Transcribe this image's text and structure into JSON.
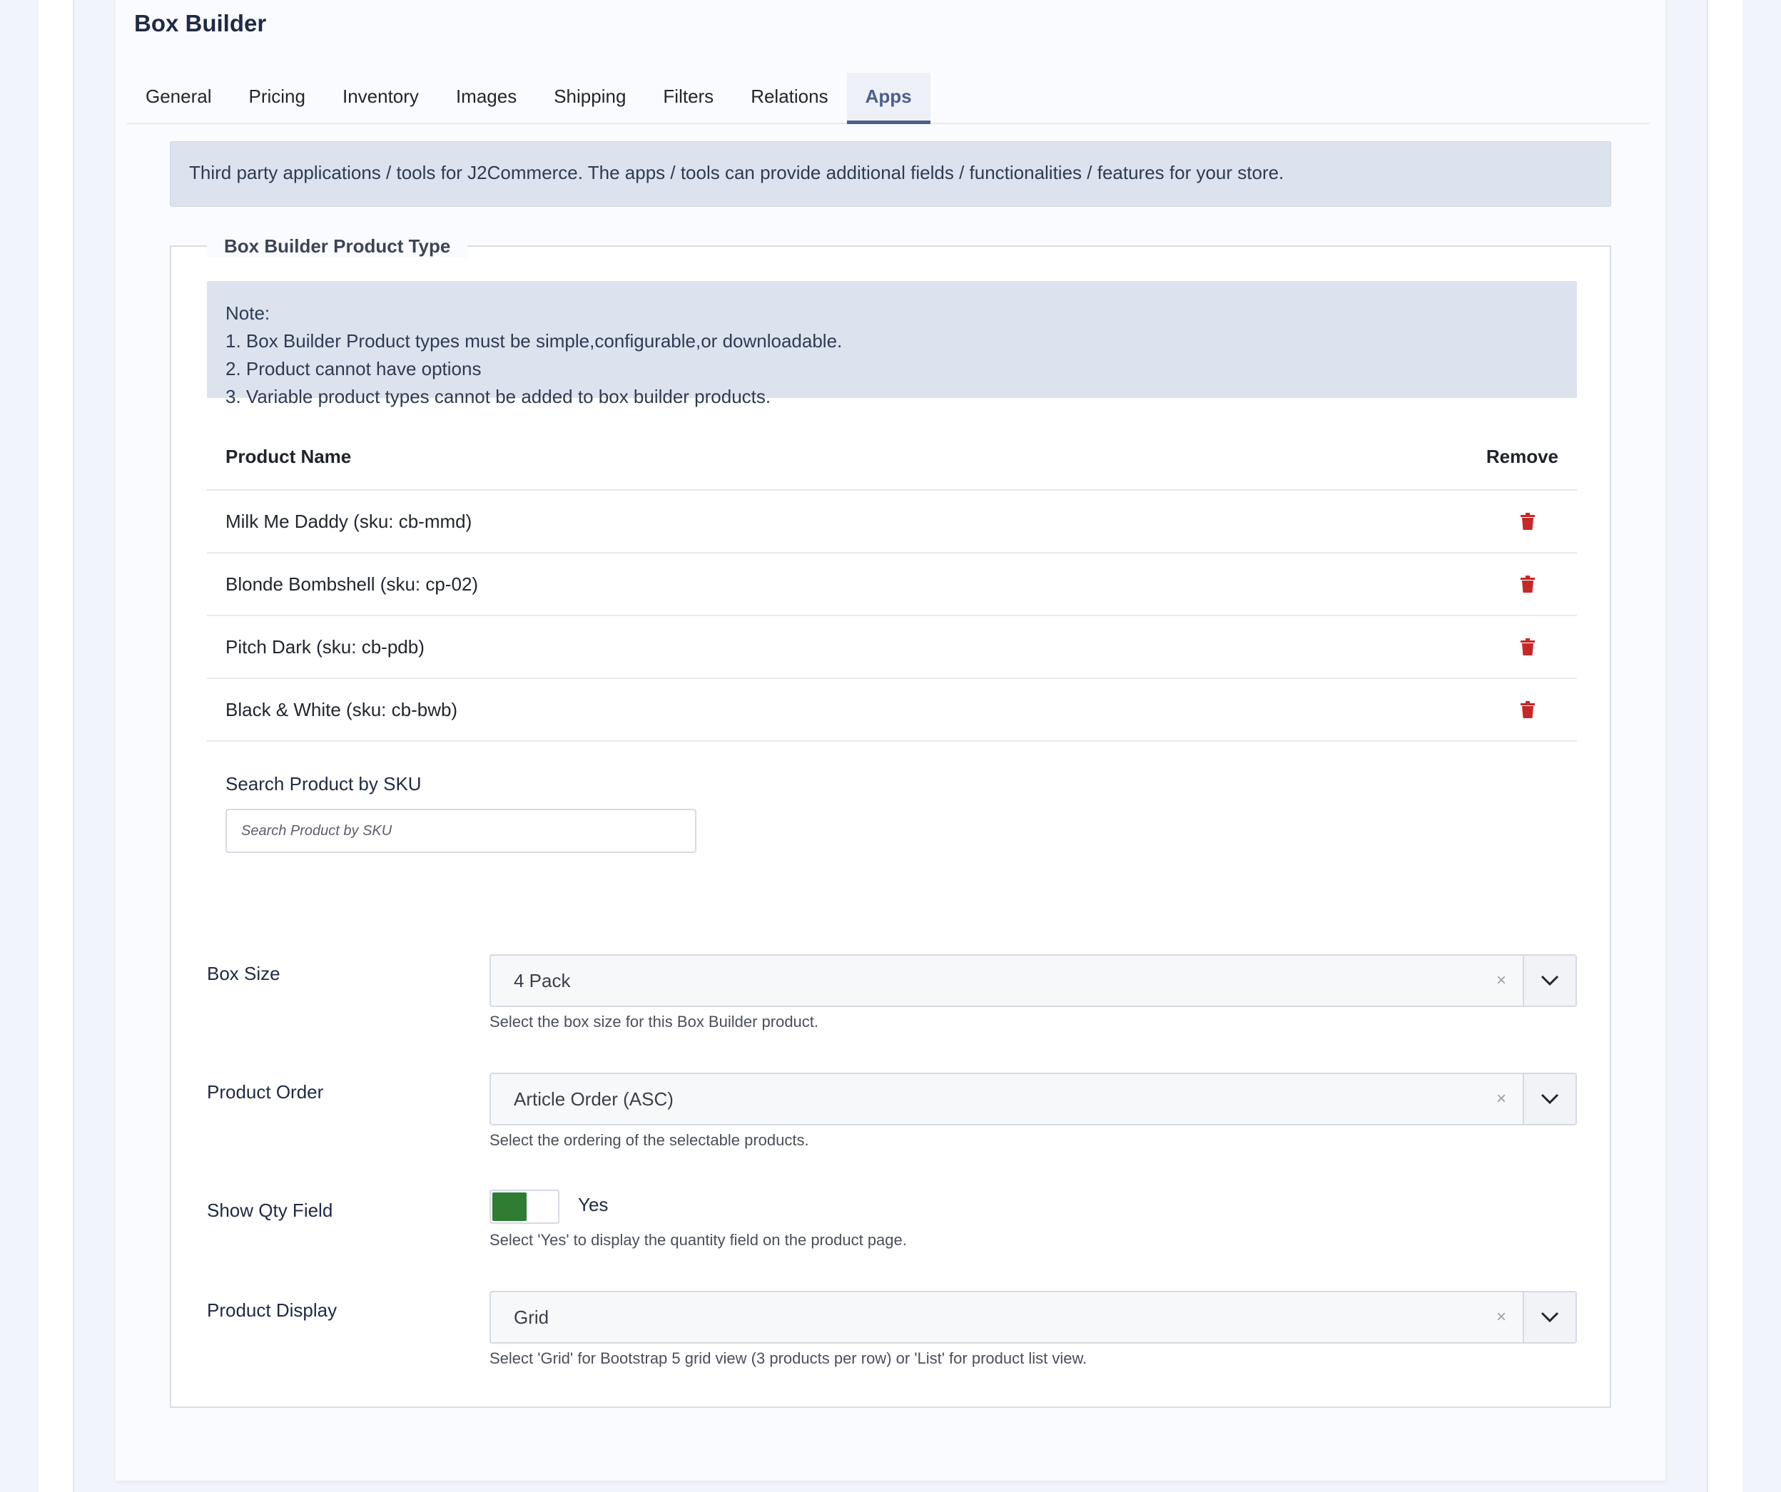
{
  "card": {
    "title": "Box Builder"
  },
  "tabs": [
    {
      "label": "General"
    },
    {
      "label": "Pricing"
    },
    {
      "label": "Inventory"
    },
    {
      "label": "Images"
    },
    {
      "label": "Shipping"
    },
    {
      "label": "Filters"
    },
    {
      "label": "Relations"
    },
    {
      "label": "Apps"
    }
  ],
  "active_tab": "Apps",
  "info_banner": "Third party applications / tools for J2Commerce. The apps / tools can provide additional fields / functionalities / features for your store.",
  "fieldset": {
    "legend": "Box Builder Product Type",
    "note": {
      "heading": "Note:",
      "lines": [
        "1. Box Builder Product types must be simple,configurable,or downloadable.",
        "2. Product cannot have options",
        "3. Variable product types cannot be added to box builder products."
      ]
    },
    "table": {
      "headers": {
        "name": "Product Name",
        "remove": "Remove"
      },
      "rows": [
        {
          "name": "Milk Me Daddy (sku: cb-mmd)"
        },
        {
          "name": "Blonde Bombshell (sku: cp-02)"
        },
        {
          "name": "Pitch Dark (sku: cb-pdb)"
        },
        {
          "name": "Black & White (sku: cb-bwb)"
        }
      ]
    },
    "search": {
      "label": "Search Product by SKU",
      "placeholder": "Search Product by SKU"
    },
    "box_size": {
      "label": "Box Size",
      "value": "4 Pack",
      "help": "Select the box size for this Box Builder product."
    },
    "product_order": {
      "label": "Product Order",
      "value": "Article Order (ASC)",
      "help": "Select the ordering of the selectable products."
    },
    "show_qty": {
      "label": "Show Qty Field",
      "value": "Yes",
      "help": "Select 'Yes' to display the quantity field on the product page."
    },
    "product_display": {
      "label": "Product Display",
      "value": "Grid",
      "help": "Select 'Grid' for Bootstrap 5 grid view (3 products per row) or 'List' for product list view."
    }
  },
  "colors": {
    "accent": "#4b5f8d",
    "danger": "#c62828",
    "toggle_on": "#2e7d32",
    "banner_bg": "#dce3ee"
  },
  "icons": {
    "remove": "trash-icon",
    "clear": "clear-icon",
    "dropdown": "chevron-down-icon"
  }
}
